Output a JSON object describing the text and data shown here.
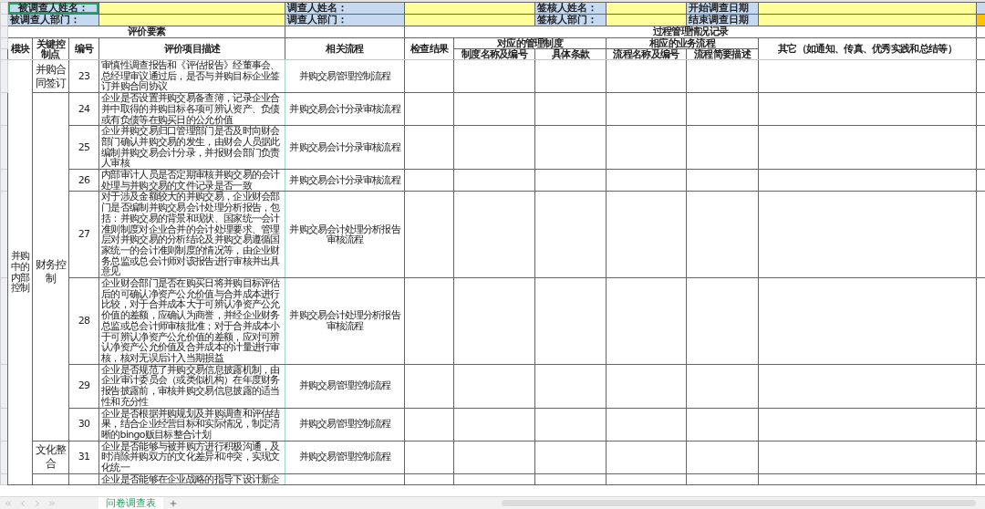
{
  "header_fields": [
    {
      "label": "被调查人姓名：",
      "selected": true
    },
    {
      "label": "调查人姓名：",
      "selected": false
    },
    {
      "label": "签核人姓名：",
      "selected": false
    },
    {
      "label": "开始调查日期",
      "selected": false
    },
    {
      "label": "被调查人部门：",
      "selected": false
    },
    {
      "label": "调查人部门：",
      "selected": false
    },
    {
      "label": "签核人部门：",
      "selected": false
    },
    {
      "label": "结束调查日期",
      "selected": false
    }
  ],
  "section_titles": [
    "评价要素",
    "过程管理情况记录"
  ],
  "column_headers": [
    {
      "label": "模块"
    },
    {
      "label": "关键控制点"
    },
    {
      "label": "编号"
    },
    {
      "label": "评价项目描述"
    },
    {
      "label": "相关流程"
    },
    {
      "label": "检查结果"
    },
    {
      "label": "对应的管理制度",
      "children": [
        {
          "label": "制度名称及编号"
        },
        {
          "label": "具体条款"
        }
      ]
    },
    {
      "label": "相应的业务流程",
      "children": [
        {
          "label": "流程名称及编号"
        },
        {
          "label": "流程简要描述"
        }
      ]
    },
    {
      "label": "其它（如通知、传真、优秀实践和总结等）"
    }
  ],
  "module": "并购中的内部控制",
  "control_points": [
    {
      "name": "并购合同签订",
      "items": [
        {
          "number": "23",
          "description": "审慎性调查报告和《评估报告》经董事会、总经理审议通过后，是否与并购目标企业签订并购合同协议",
          "process": "并购交易管理控制流程"
        }
      ]
    },
    {
      "name": "财务控制",
      "items": [
        {
          "number": "24",
          "description": "企业是否设置并购交易备查簿，记录企业合并中取得的并购目标各项可辨认资产、负债或有负债等在购买日的公允价值",
          "process": "并购交易会计分录审核流程"
        },
        {
          "number": "25",
          "description": "企业并购交易归口管理部门是否及时向财会部门确认并购交易的发生，由财会人员据此编制并购交易会计分录，并报财会部门负责人审核",
          "process": "并购交易会计分录审核流程"
        },
        {
          "number": "26",
          "description": "内部审计人员是否定期审核并购交易的会计处理与并购交易的文件记录是否一致",
          "process": "并购交易会计分录审核流程"
        },
        {
          "number": "27",
          "description": "对于涉及金额较大的并购交易，企业财会部门是否编制并购交易会计处理分析报告，包括：并购交易的背景和现状、国家统一会计准则制度对企业合并的会计处理要求、管理层对并购交易的分析结论及并购交易遵循国家统一的会计准则制度的情况等，由企业财务总监或总会计师对该报告进行审核并出具意见",
          "process": "并购交易会计处理分析报告审核流程"
        },
        {
          "number": "28",
          "description": "企业财会部门是否在购买日将并购目标评估后的可确认净资产公允价值与合并成本进行比较，对于合并成本大于可辨认净资产公允价值的差额，应确认为商誉，并经企业财务总监或总会计师审核批准；对于合并成本小于可辨认净资产公允价值的差额，应对可辨认净资产公允价值及合并成本的计量进行审核，核对无误后计入当期损益",
          "process": "并购交易会计处理分析报告审核流程"
        },
        {
          "number": "29",
          "description": "企业是否规范了并购交易信息披露机制，由企业审计委员会（或类似机构）在年度财务报告披露前，审核并购交易信息披露的适当性和充分性",
          "process": "并购交易管理控制流程"
        },
        {
          "number": "30",
          "description": "企业是否根据并购规划及并购调查和评估结果，结合企业经营目标和实际情况，制定清晰的bingo贩目标整合计划",
          "process": "并购交易管理控制流程"
        }
      ]
    },
    {
      "name": "文化整合",
      "items": [
        {
          "number": "31",
          "description": "企业是否能够与被并购方进行积极沟通，及时消除并购双方的文化差异和冲突，实现文化统一",
          "process": "并购交易管理控制流程"
        }
      ]
    },
    {
      "items": [
        {
          "description": "企业是否能够在企业战略的指导下设计新企"
        }
      ]
    }
  ],
  "sheet_tabs": [
    {
      "label": "问卷调查表",
      "selected": true
    }
  ]
}
